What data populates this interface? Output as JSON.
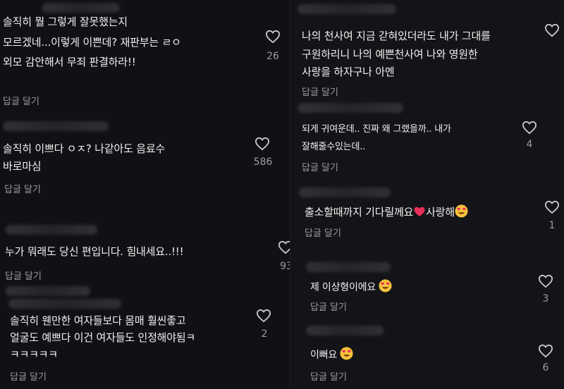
{
  "reply_label": "답글 달기",
  "colors": {
    "heart_stroke": "#c8c9cc",
    "red_heart": "#e8305a",
    "emoji_face": "#f5c33b"
  },
  "left": [
    {
      "lines": [
        "솔직히 뭘 그렇게 잘못했는지",
        "모르겠네...이렇게 이쁜데? 재판부는 ㄹㅇ",
        "외모 감안해서 무죄 판결하라!!"
      ],
      "likes": "26"
    },
    {
      "lines": [
        "솔직히 이쁘다 ㅇㅈ? 나같아도 음료수",
        "바로마심"
      ],
      "likes": "586"
    },
    {
      "lines": [
        "누가 뭐래도 당신 편입니다. 힘내세요..!!!"
      ],
      "likes": "93"
    },
    {
      "lines": [
        "솔직히 웬만한 여자들보다 몸매 훨씬좋고",
        "얼굴도 예쁘다 이건 여자들도 인정해야됨ㅋ",
        "ㅋㅋㅋㅋㅋ"
      ],
      "likes": "2"
    }
  ],
  "right": [
    {
      "lines": [
        "나의 천사여 지금 갇혀있더라도 내가 그대를",
        "구원하리니 나의 예쁜천사여 나와 영원한",
        "사랑을 하자구나 아멘"
      ],
      "likes": ""
    },
    {
      "lines": [
        "되게 귀여운데.. 진짜 왜 그랬을까.. 내가",
        "잘해줄수있는데.."
      ],
      "likes": "4"
    },
    {
      "text_a": "출소할때까지 기다릴께요",
      "text_b": "사랑해",
      "emojis": [
        "red-heart",
        "heart-eyes"
      ],
      "likes": "1"
    },
    {
      "text": "제 이상형이에요",
      "emojis": [
        "heart-eyes"
      ],
      "likes": "3"
    },
    {
      "text": "이뻐요",
      "emojis": [
        "heart-eyes"
      ],
      "likes": "6"
    }
  ]
}
